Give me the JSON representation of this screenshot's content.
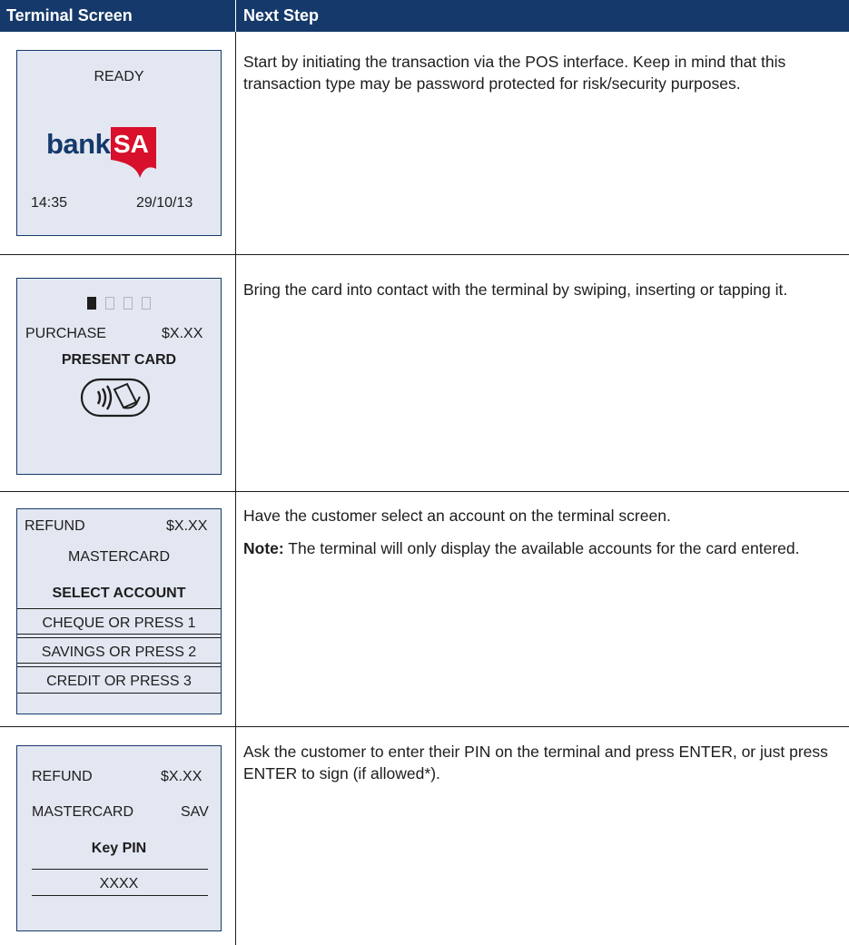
{
  "header": {
    "col_terminal": "Terminal Screen",
    "col_next": "Next Step"
  },
  "rows": [
    {
      "screen": {
        "status": "READY",
        "logo_text_1": "bank",
        "logo_text_2": "SA",
        "time": "14:35",
        "date": "29/10/13"
      },
      "step": "Start by initiating the transaction via the POS interface. Keep in mind that this transaction type may be password protected for risk/security purposes."
    },
    {
      "screen": {
        "label": "PURCHASE",
        "amount": "$X.XX",
        "prompt": "PRESENT CARD",
        "progress": "1 of 4"
      },
      "step": "Bring the card into contact with the terminal by swiping, inserting or tapping it."
    },
    {
      "screen": {
        "label": "REFUND",
        "amount": "$X.XX",
        "card": "MASTERCARD",
        "prompt": "SELECT ACCOUNT",
        "options": [
          "CHEQUE OR PRESS 1",
          "SAVINGS OR PRESS 2",
          "CREDIT OR PRESS 3"
        ]
      },
      "step": "Have the customer select an account on the terminal screen.",
      "note_label": "Note:",
      "note": "The terminal will only display the available accounts for the card entered."
    },
    {
      "screen": {
        "label": "REFUND",
        "amount": "$X.XX",
        "card": "MASTERCARD",
        "account": "SAV",
        "prompt": "Key PIN",
        "pin": "XXXX"
      },
      "step": "Ask the customer to enter their PIN on the terminal and press ENTER, or just press ENTER to sign (if allowed*)."
    }
  ],
  "colors": {
    "header_bg": "#15396b",
    "panel_bg": "#e3e7f1",
    "brand_red": "#d8102b",
    "brand_navy": "#15396b"
  },
  "icons": [
    "contactless-card-icon"
  ]
}
